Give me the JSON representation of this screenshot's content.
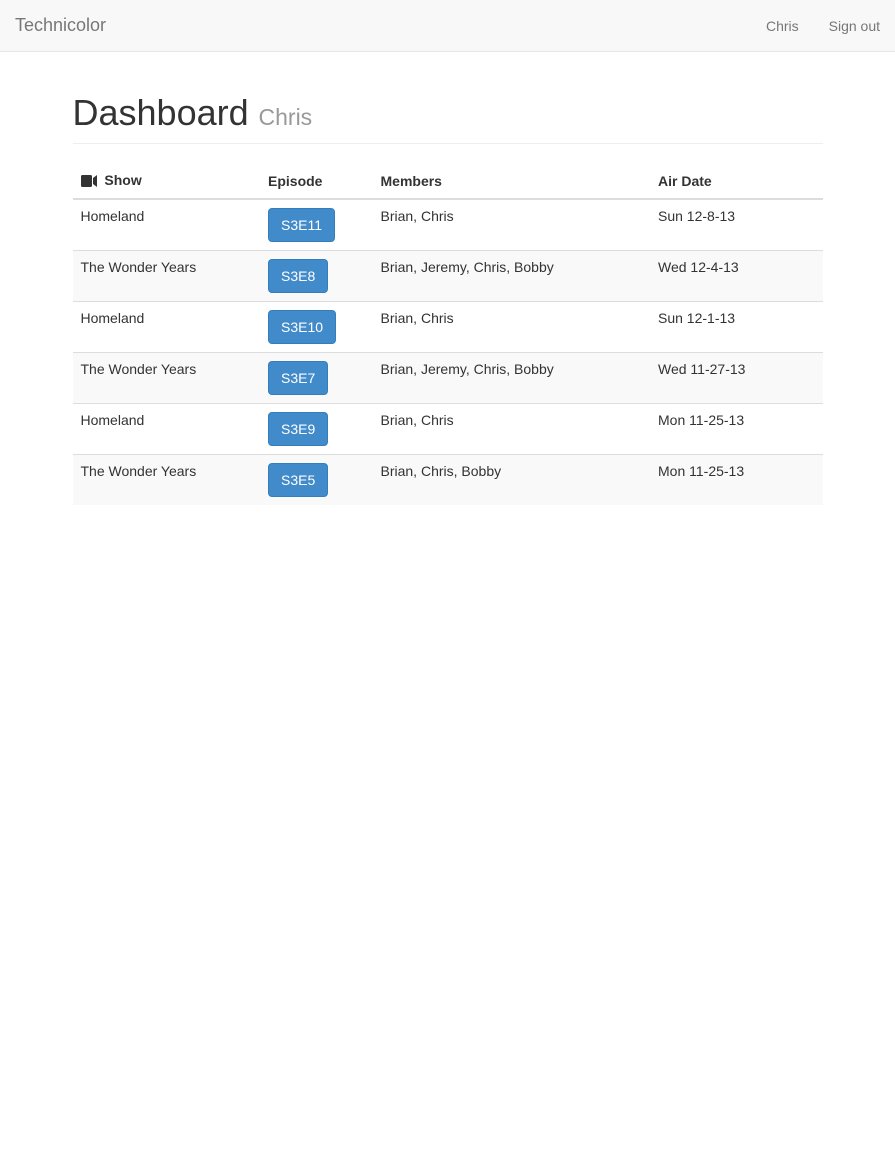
{
  "navbar": {
    "brand": "Technicolor",
    "user_link": "Chris",
    "signout_link": "Sign out"
  },
  "header": {
    "title": "Dashboard",
    "subtitle": "Chris"
  },
  "table": {
    "headers": {
      "show": "Show",
      "episode": "Episode",
      "members": "Members",
      "air_date": "Air Date"
    },
    "rows": [
      {
        "show": "Homeland",
        "episode": "S3E11",
        "members": "Brian, Chris",
        "air_date": "Sun 12-8-13"
      },
      {
        "show": "The Wonder Years",
        "episode": "S3E8",
        "members": "Brian, Jeremy, Chris, Bobby",
        "air_date": "Wed 12-4-13"
      },
      {
        "show": "Homeland",
        "episode": "S3E10",
        "members": "Brian, Chris",
        "air_date": "Sun 12-1-13"
      },
      {
        "show": "The Wonder Years",
        "episode": "S3E7",
        "members": "Brian, Jeremy, Chris, Bobby",
        "air_date": "Wed 11-27-13"
      },
      {
        "show": "Homeland",
        "episode": "S3E9",
        "members": "Brian, Chris",
        "air_date": "Mon 11-25-13"
      },
      {
        "show": "The Wonder Years",
        "episode": "S3E5",
        "members": "Brian, Chris, Bobby",
        "air_date": "Mon 11-25-13"
      }
    ]
  }
}
